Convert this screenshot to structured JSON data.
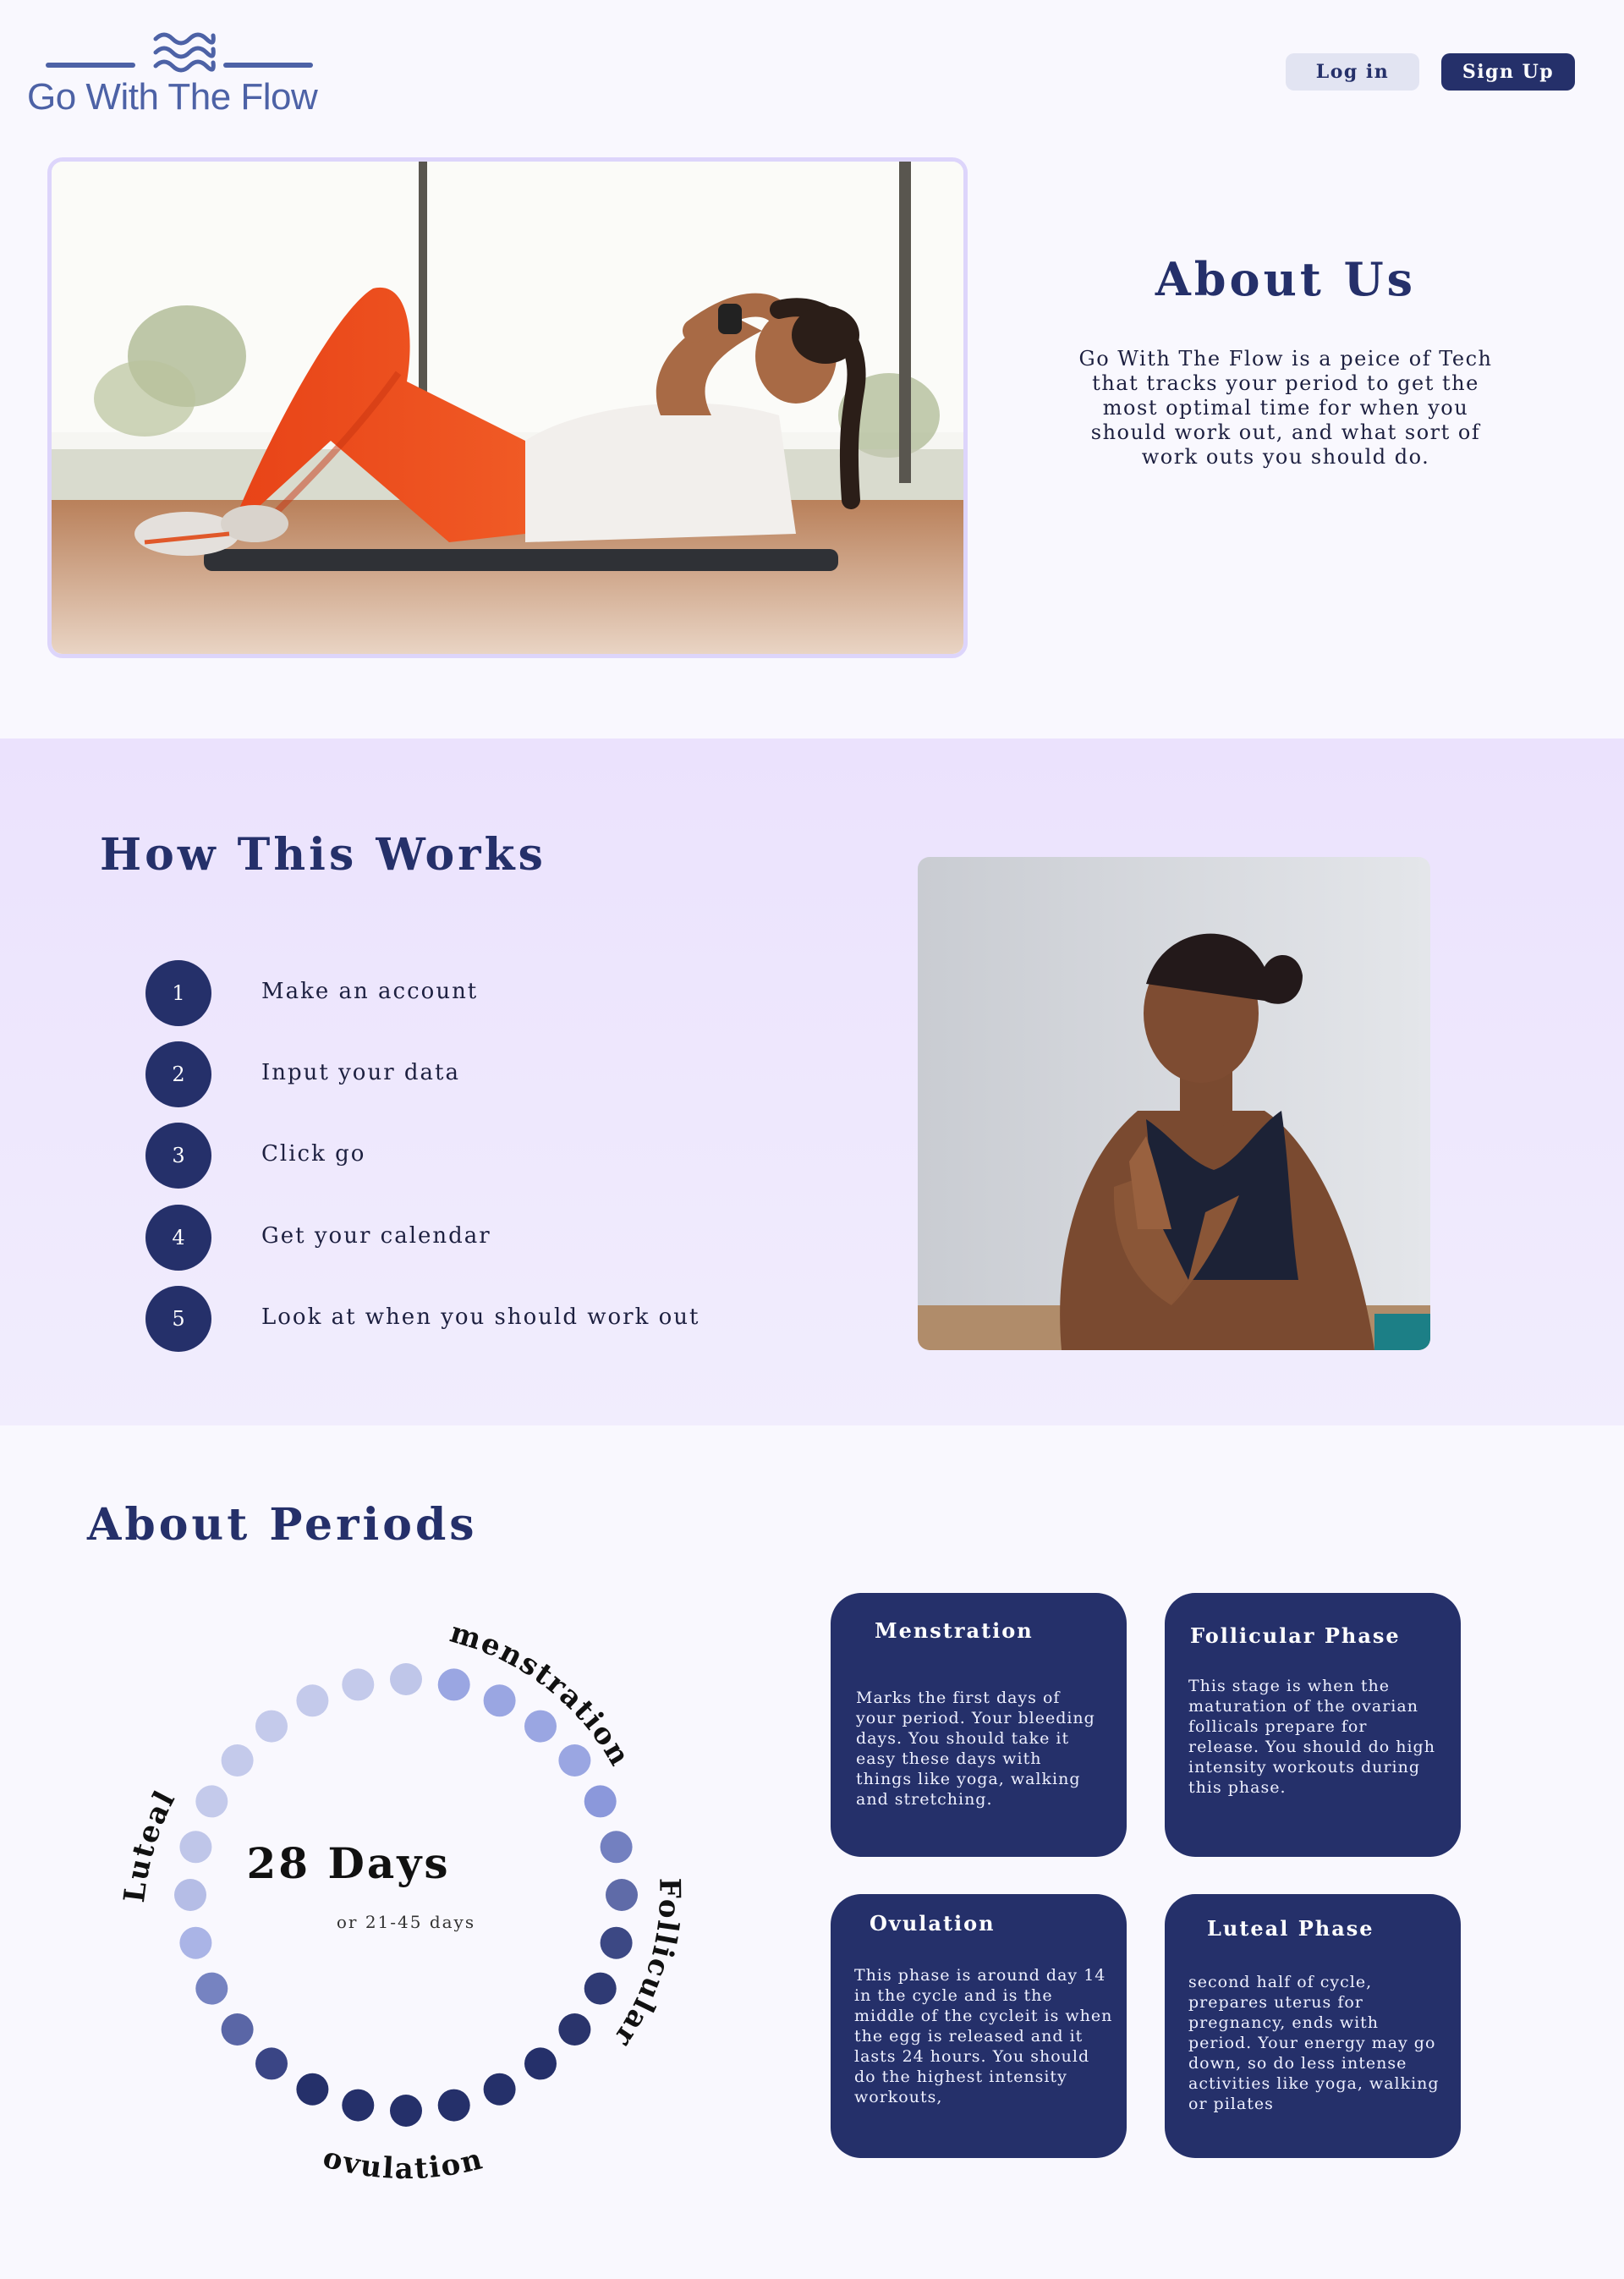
{
  "header": {
    "brand": "Go With The Flow",
    "login_label": "Log in",
    "signup_label": "Sign Up"
  },
  "about": {
    "title": "About Us",
    "text": "Go With The Flow is a peice of Tech that tracks your period to get the most optimal time for when you should work out, and what sort of work outs you should do."
  },
  "how": {
    "title": "How This Works",
    "steps": [
      {
        "num": "1",
        "label": "Make an account"
      },
      {
        "num": "2",
        "label": "Input your data"
      },
      {
        "num": "3",
        "label": "Click go"
      },
      {
        "num": "4",
        "label": "Get your calendar"
      },
      {
        "num": "5",
        "label": "Look at when you should work out"
      }
    ]
  },
  "periods": {
    "title": "About Periods",
    "days_big": "28 Days",
    "days_small": "or 21-45 days",
    "phase_labels": {
      "menstration": "menstration",
      "follicular": "Follicular",
      "ovulation": "ovulation",
      "luteal": "Luteal"
    },
    "cards": [
      {
        "title": "Menstration",
        "body": "Marks the first days of your period. Your bleeding days. You should take it easy these days with things like yoga, walking and stretching."
      },
      {
        "title": "Follicular Phase",
        "body": "This stage is when the maturation of the ovarian follicals prepare for release. You should do high intensity workouts during this phase."
      },
      {
        "title": "Ovulation",
        "body": "This phase is around day 14 in the cycle and is the middle of the cycleit is when the egg is released and it lasts 24 hours. You should do the highest intensity workouts,"
      },
      {
        "title": "Luteal Phase",
        "body": "second half of cycle, prepares uterus for pregnancy, ends with period. Your energy may go down, so do less intense activities like yoga, walking or pilates"
      }
    ]
  },
  "colors": {
    "navy": "#25306a",
    "brand_blue": "#4d62a6",
    "lavender": "#ebe2fd",
    "frame_border": "#ddd5fb"
  }
}
